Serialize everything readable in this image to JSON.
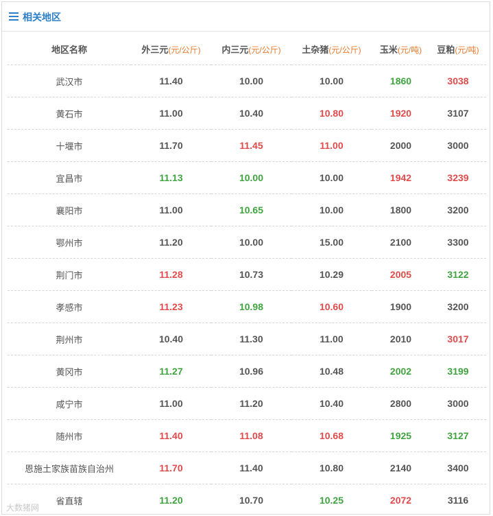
{
  "header": {
    "title": "相关地区",
    "icon": "menu-icon"
  },
  "colors": {
    "accent": "#2a7fc8",
    "up": "#e04a4a",
    "down": "#3fa33f",
    "unit": "#e87a2c",
    "neutral": "#555555"
  },
  "table": {
    "columns": [
      {
        "label": "地区名称",
        "unit": ""
      },
      {
        "label": "外三元",
        "unit": "(元/公斤)"
      },
      {
        "label": "内三元",
        "unit": "(元/公斤)"
      },
      {
        "label": "土杂猪",
        "unit": "(元/公斤)"
      },
      {
        "label": "玉米",
        "unit": "(元/吨)"
      },
      {
        "label": "豆粕",
        "unit": "(元/吨)"
      }
    ],
    "rows": [
      {
        "region": "武汉市",
        "cells": [
          {
            "v": "11.40",
            "s": ""
          },
          {
            "v": "10.00",
            "s": ""
          },
          {
            "v": "10.00",
            "s": ""
          },
          {
            "v": "1860",
            "s": "down"
          },
          {
            "v": "3038",
            "s": "up"
          }
        ]
      },
      {
        "region": "黄石市",
        "cells": [
          {
            "v": "11.00",
            "s": ""
          },
          {
            "v": "10.40",
            "s": ""
          },
          {
            "v": "10.80",
            "s": "up"
          },
          {
            "v": "1920",
            "s": "up"
          },
          {
            "v": "3107",
            "s": ""
          }
        ]
      },
      {
        "region": "十堰市",
        "cells": [
          {
            "v": "11.70",
            "s": ""
          },
          {
            "v": "11.45",
            "s": "up"
          },
          {
            "v": "11.00",
            "s": "up"
          },
          {
            "v": "2000",
            "s": ""
          },
          {
            "v": "3000",
            "s": ""
          }
        ]
      },
      {
        "region": "宜昌市",
        "cells": [
          {
            "v": "11.13",
            "s": "down"
          },
          {
            "v": "10.00",
            "s": "down"
          },
          {
            "v": "10.00",
            "s": ""
          },
          {
            "v": "1942",
            "s": "up"
          },
          {
            "v": "3239",
            "s": "up"
          }
        ]
      },
      {
        "region": "襄阳市",
        "cells": [
          {
            "v": "11.00",
            "s": ""
          },
          {
            "v": "10.65",
            "s": "down"
          },
          {
            "v": "10.00",
            "s": ""
          },
          {
            "v": "1800",
            "s": ""
          },
          {
            "v": "3200",
            "s": ""
          }
        ]
      },
      {
        "region": "鄂州市",
        "cells": [
          {
            "v": "11.20",
            "s": ""
          },
          {
            "v": "10.00",
            "s": ""
          },
          {
            "v": "15.00",
            "s": ""
          },
          {
            "v": "2100",
            "s": ""
          },
          {
            "v": "3300",
            "s": ""
          }
        ]
      },
      {
        "region": "荆门市",
        "cells": [
          {
            "v": "11.28",
            "s": "up"
          },
          {
            "v": "10.73",
            "s": ""
          },
          {
            "v": "10.29",
            "s": ""
          },
          {
            "v": "2005",
            "s": "up"
          },
          {
            "v": "3122",
            "s": "down"
          }
        ]
      },
      {
        "region": "孝感市",
        "cells": [
          {
            "v": "11.23",
            "s": "up"
          },
          {
            "v": "10.98",
            "s": "down"
          },
          {
            "v": "10.60",
            "s": "up"
          },
          {
            "v": "1900",
            "s": ""
          },
          {
            "v": "3200",
            "s": ""
          }
        ]
      },
      {
        "region": "荆州市",
        "cells": [
          {
            "v": "10.40",
            "s": ""
          },
          {
            "v": "11.30",
            "s": ""
          },
          {
            "v": "11.00",
            "s": ""
          },
          {
            "v": "2010",
            "s": ""
          },
          {
            "v": "3017",
            "s": "up"
          }
        ]
      },
      {
        "region": "黄冈市",
        "cells": [
          {
            "v": "11.27",
            "s": "down"
          },
          {
            "v": "10.96",
            "s": ""
          },
          {
            "v": "10.48",
            "s": ""
          },
          {
            "v": "2002",
            "s": "down"
          },
          {
            "v": "3199",
            "s": "down"
          }
        ]
      },
      {
        "region": "咸宁市",
        "cells": [
          {
            "v": "11.00",
            "s": ""
          },
          {
            "v": "11.20",
            "s": ""
          },
          {
            "v": "10.40",
            "s": ""
          },
          {
            "v": "2800",
            "s": ""
          },
          {
            "v": "3000",
            "s": ""
          }
        ]
      },
      {
        "region": "随州市",
        "cells": [
          {
            "v": "11.40",
            "s": "up"
          },
          {
            "v": "11.08",
            "s": "up"
          },
          {
            "v": "10.68",
            "s": "up"
          },
          {
            "v": "1925",
            "s": "down"
          },
          {
            "v": "3127",
            "s": "down"
          }
        ]
      },
      {
        "region": "恩施土家族苗族自治州",
        "cells": [
          {
            "v": "11.70",
            "s": "up"
          },
          {
            "v": "11.40",
            "s": ""
          },
          {
            "v": "10.80",
            "s": ""
          },
          {
            "v": "2140",
            "s": ""
          },
          {
            "v": "3400",
            "s": ""
          }
        ]
      },
      {
        "region": "省直辖",
        "cells": [
          {
            "v": "11.20",
            "s": "down"
          },
          {
            "v": "10.70",
            "s": ""
          },
          {
            "v": "10.25",
            "s": "down"
          },
          {
            "v": "2072",
            "s": "up"
          },
          {
            "v": "3116",
            "s": ""
          }
        ]
      }
    ]
  },
  "watermark": {
    "text": "大数猪网"
  }
}
